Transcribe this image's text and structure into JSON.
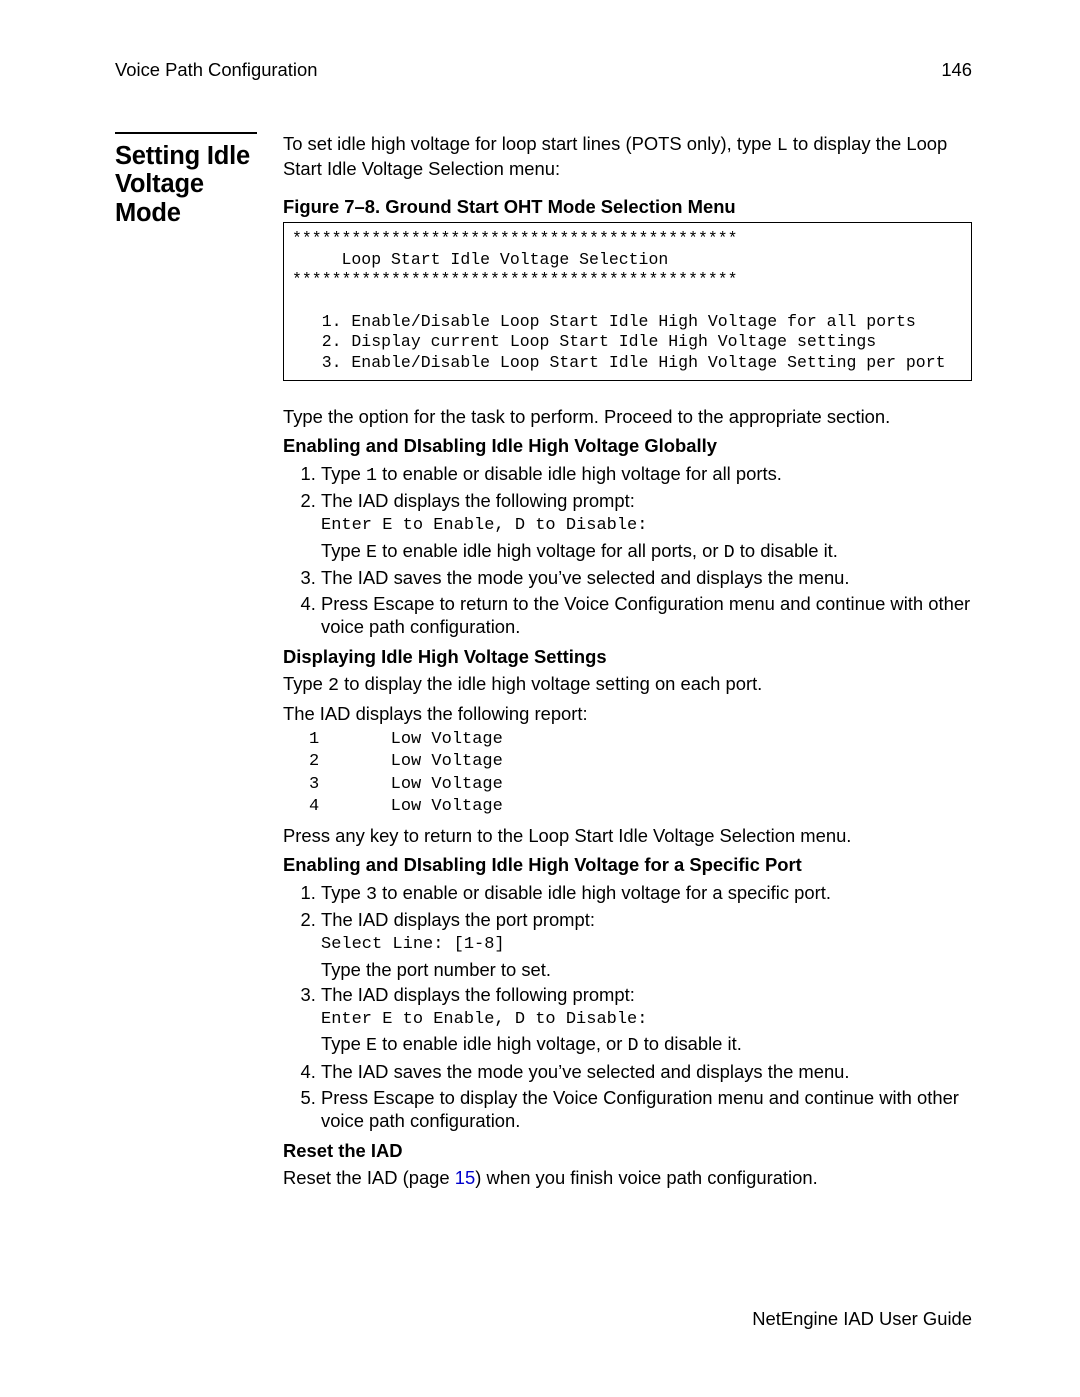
{
  "header": {
    "left": "Voice Path Configuration",
    "right": "146"
  },
  "sidebar": {
    "heading": "Setting Idle Voltage Mode"
  },
  "intro": {
    "part1": "To set idle high voltage for loop start lines (POTS only), type ",
    "code": "L",
    "part2": " to display the Loop Start Idle Voltage Selection menu:"
  },
  "figure": {
    "caption": "Figure 7–8.  Ground Start OHT Mode Selection Menu",
    "body": "*********************************************\n     Loop Start Idle Voltage Selection\n*********************************************\n\n   1. Enable/Disable Loop Start Idle High Voltage for all ports\n   2. Display current Loop Start Idle High Voltage settings\n   3. Enable/Disable Loop Start Idle High Voltage Setting per port"
  },
  "after_figure": "Type the option for the task to perform. Proceed to the appropriate section.",
  "global": {
    "heading": "Enabling and DIsabling Idle High Voltage Globally",
    "s1": {
      "p1": "Type ",
      "code": "1",
      "p2": " to enable or disable idle high voltage for all ports."
    },
    "s2": {
      "line1": "The IAD displays the following prompt:",
      "code": "Enter E to Enable, D to Disable:",
      "line2": {
        "p1": "Type ",
        "c1": "E",
        "p2": " to enable idle high voltage for all ports, or ",
        "c2": "D",
        "p3": " to disable it."
      }
    },
    "s3": "The IAD saves the mode you’ve selected and displays the menu.",
    "s4": "Press Escape to return to the Voice Configuration menu and continue with other voice path configuration."
  },
  "display": {
    "heading": "Displaying Idle High Voltage Settings",
    "p1": {
      "a": "Type ",
      "code": "2",
      "b": " to display the idle high voltage setting on each port."
    },
    "p2": "The IAD displays the following report:",
    "report": "1       Low Voltage\n2       Low Voltage\n3       Low Voltage\n4       Low Voltage",
    "p3": "Press any key to return to the Loop Start Idle Voltage Selection menu."
  },
  "specific": {
    "heading": "Enabling and DIsabling Idle High Voltage for a Specific Port",
    "s1": {
      "p1": "Type ",
      "code": "3",
      "p2": " to enable or disable idle high voltage for a specific port."
    },
    "s2": {
      "line1": "The IAD displays the port prompt:",
      "code": "Select Line: [1-8]",
      "line2": "Type the port number to set."
    },
    "s3": {
      "line1": "The IAD displays the following prompt:",
      "code": "Enter E to Enable, D to Disable:",
      "line2": {
        "p1": "Type ",
        "c1": "E",
        "p2": " to enable idle high voltage, or ",
        "c2": "D",
        "p3": " to disable it."
      }
    },
    "s4": "The IAD saves the mode you’ve selected and displays the menu.",
    "s5": "Press Escape to display the Voice Configuration menu and continue with other voice path configuration."
  },
  "reset": {
    "heading": "Reset the IAD",
    "sentence": {
      "p1": "Reset the IAD (page ",
      "link": "15",
      "p2": ") when you finish voice path configuration."
    }
  },
  "footer": "NetEngine IAD User Guide"
}
